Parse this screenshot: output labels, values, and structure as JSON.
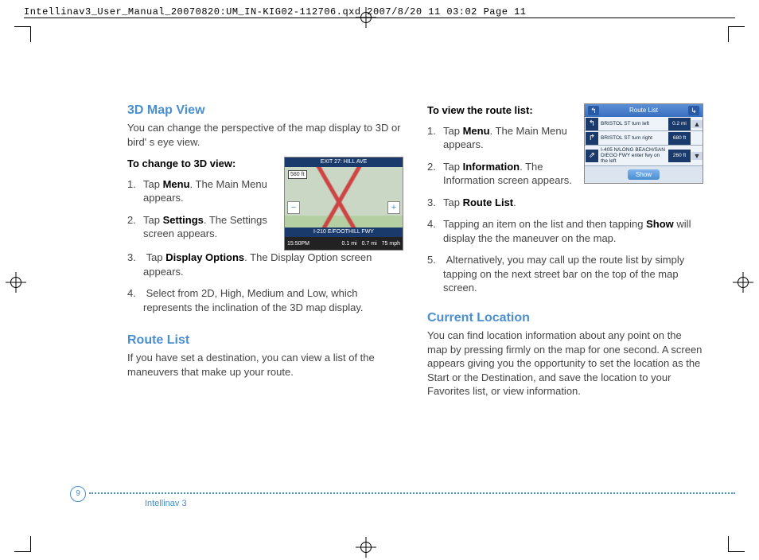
{
  "header_line": "Intellinav3_User_Manual_20070820:UM_IN-KIG02-112706.qxd  2007/8/20  11  03:02  Page 11",
  "left": {
    "h1": "3D Map View",
    "intro": "You can change the perspective of the map display to 3D or bird' s eye view.",
    "sub": "To change to 3D view:",
    "s1a": "Tap ",
    "s1b": "Menu",
    "s1c": ". The Main Menu appears.",
    "s2a": "Tap ",
    "s2b": "Settings",
    "s2c": ".  The Settings screen appears.",
    "s3a": "Tap ",
    "s3b": "Display Options",
    "s3c": ".  The Display Option screen appears.",
    "s4": "Select from 2D, High, Medium and Low, which represents the inclination of the 3D map display.",
    "h2": "Route List",
    "p2": "If you have set a destination, you can view a list of the maneuvers that make up your route."
  },
  "right": {
    "sub": "To view the route list:",
    "s1a": "Tap ",
    "s1b": "Menu",
    "s1c": ". The Main Menu appears.",
    "s2a": "Tap ",
    "s2b": "Information",
    "s2c": ".  The Information screen appears.",
    "s3a": "Tap ",
    "s3b": "Route List",
    "s3c": ".",
    "s4a": "Tapping an item on the list and then tapping ",
    "s4b": "Show",
    "s4c": " will display the the maneuver on the map.",
    "s5": "Alternatively, you may call up the route list by simply tapping on the next street bar on the top of the map screen.",
    "h2": "Current Location",
    "p2": "You can find location information about any point on the map by pressing firmly on the map for one second. A screen appears giving you the opportunity to set the location as the Start or the Destination, and save the location to your Favorites list, or view information."
  },
  "map": {
    "top": "EXIT 27: HILL AVE",
    "badge": "580 ft",
    "street": "I-210 E/FOOTHILL FWY",
    "time": "15:50PM",
    "d1": "0.1 mi",
    "d2": "0.7 mi",
    "spd": "75 mph"
  },
  "route": {
    "title": "Route List",
    "r1": "BRISTOL ST turn left",
    "d1": "0.2 mi",
    "r2": "BRISTOL ST turn right",
    "d2": "680 ft",
    "r3": "I-405 N/LONG BEACH/SAN DIEGO FWY enter fwy on the left",
    "d3": "260 ft",
    "show": "Show"
  },
  "footer": {
    "page": "9",
    "label": "Intellinav 3"
  }
}
